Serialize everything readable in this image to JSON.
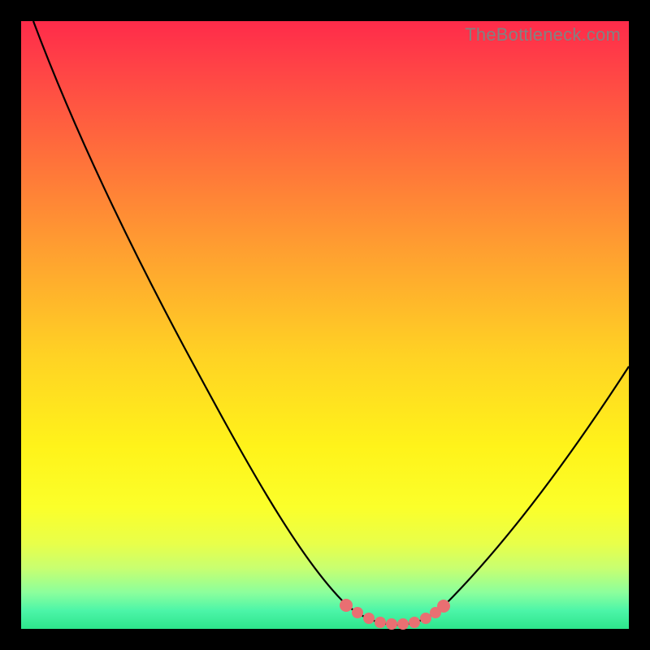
{
  "watermark": "TheBottleneck.com",
  "chart_data": {
    "type": "line",
    "title": "",
    "xlabel": "",
    "ylabel": "",
    "xlim": [
      0,
      100
    ],
    "ylim": [
      0,
      100
    ],
    "series": [
      {
        "name": "bottleneck-curve",
        "x": [
          2,
          5,
          10,
          15,
          20,
          25,
          30,
          35,
          40,
          45,
          50,
          54,
          57,
          60,
          63,
          66,
          70,
          75,
          80,
          85,
          90,
          95,
          100
        ],
        "y": [
          100,
          95,
          86,
          77,
          68,
          58,
          49,
          40,
          30,
          21,
          12,
          5,
          2,
          1,
          1,
          2,
          5,
          12,
          21,
          30,
          39,
          48,
          57
        ]
      }
    ],
    "markers": {
      "name": "highlight-dots",
      "color": "#e96f72",
      "x_range": [
        53,
        70
      ],
      "y": 1
    }
  },
  "colors": {
    "background": "#000000",
    "curve": "#000000",
    "marker": "#e96f72"
  }
}
